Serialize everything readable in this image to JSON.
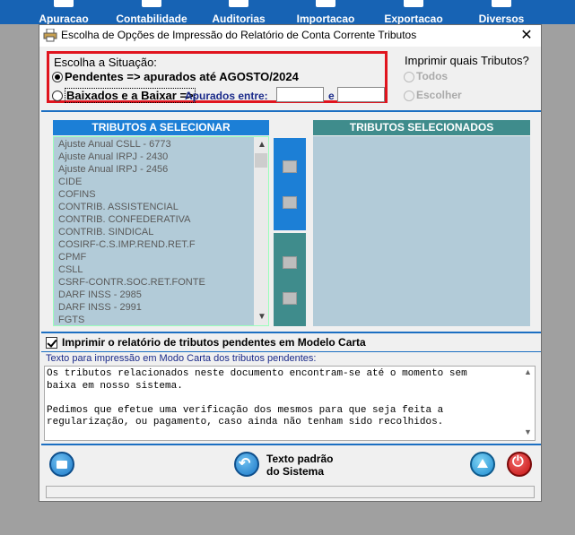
{
  "toolbar": {
    "items": [
      {
        "label": "Apuracao"
      },
      {
        "label": "Contabilidade"
      },
      {
        "label": "Auditorias"
      },
      {
        "label": "Importacao"
      },
      {
        "label": "Exportacao"
      },
      {
        "label": "Diversos"
      }
    ]
  },
  "dialog": {
    "title": "Escolha de Opções de Impressão do Relatório de Conta Corrente Tributos",
    "close_label": "✕"
  },
  "situacao": {
    "title": "Escolha a Situação:",
    "option1": "Pendentes => apurados até AGOSTO/2024",
    "option2": "Baixados e a Baixar =>",
    "apurados_label": "Apurados entre:",
    "e_label": "e",
    "date_from": "",
    "date_to": ""
  },
  "imprimir": {
    "title": "Imprimir quais Tributos?",
    "option1": "Todos",
    "option2": "Escolher"
  },
  "lists": {
    "left_header": "TRIBUTOS  A  SELECIONAR",
    "right_header": "TRIBUTOS  SELECIONADOS",
    "left_items": [
      "Ajuste Anual CSLL - 6773",
      "Ajuste Anual IRPJ - 2430",
      "Ajuste Anual IRPJ - 2456",
      "CIDE",
      "COFINS",
      "CONTRIB. ASSISTENCIAL",
      "CONTRIB. CONFEDERATIVA",
      "CONTRIB. SINDICAL",
      "COSIRF-C.S.IMP.REND.RET.F",
      "CPMF",
      "CSLL",
      "CSRF-CONTR.SOC.RET.FONTE",
      "DARF INSS - 2985",
      "DARF INSS - 2991",
      "FGTS"
    ]
  },
  "carta": {
    "checkbox_label": "Imprimir o relatório de tributos pendentes em Modelo Carta",
    "text_label": "Texto para impressão em Modo Carta dos tributos pendentes:",
    "text": "Os tributos relacionados neste documento encontram-se até o momento sem\nbaixa em nosso sistema.\n\nPedimos que efetue uma verificação dos mesmos para que seja feita a\nregularização, ou pagamento, caso ainda não tenham sido recolhidos."
  },
  "buttons": {
    "texto_padrao_line1": "Texto padrão",
    "texto_padrao_line2": "do Sistema"
  }
}
